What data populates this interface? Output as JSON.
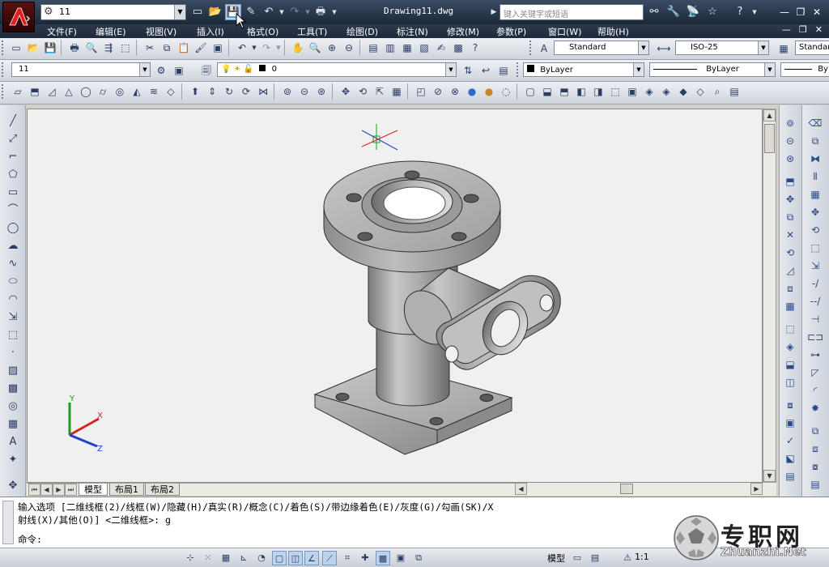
{
  "titlebar": {
    "workspace": "11",
    "document_title": "Drawing11.dwg",
    "search_placeholder": "键入关键字或短语"
  },
  "menu": [
    "文件(F)",
    "编辑(E)",
    "视图(V)",
    "插入(I)",
    "格式(O)",
    "工具(T)",
    "绘图(D)",
    "标注(N)",
    "修改(M)",
    "参数(P)",
    "窗口(W)",
    "帮助(H)"
  ],
  "styles": {
    "text_style": "Standard",
    "dim_style": "ISO-25",
    "table_style": "Standard"
  },
  "layers": {
    "workspace": "11",
    "current_layer": "0",
    "color": "ByLayer",
    "linetype": "ByLayer",
    "lineweight": "ByLayer"
  },
  "tabs": [
    "模型",
    "布局1",
    "布局2"
  ],
  "command": {
    "history_line1": "输入选项 [二维线框(2)/线框(W)/隐藏(H)/真实(R)/概念(C)/着色(S)/带边缘着色(E)/灰度(G)/勾画(SK)/X",
    "history_line2": "射线(X)/其他(O)] <二维线框>: g",
    "prompt": "命令:"
  },
  "status": {
    "model_label": "模型",
    "scale": "1:1"
  },
  "ucs_labels": {
    "x": "X",
    "y": "Y",
    "z": "Z"
  },
  "watermark": {
    "text": "专职网",
    "url": "Zhuanzhi.Net"
  }
}
